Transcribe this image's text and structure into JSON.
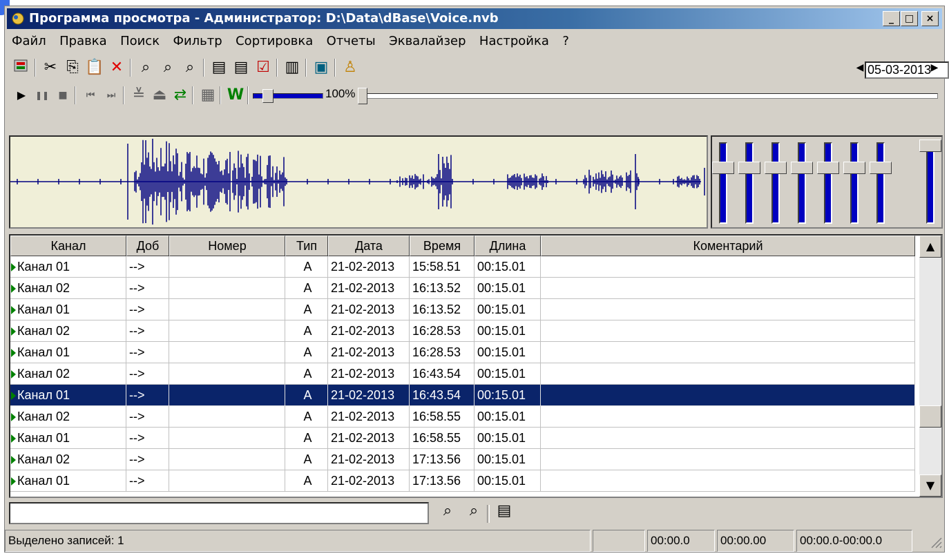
{
  "window": {
    "title": "Программа просмотра - Администратор: D:\\Data\\dBase\\Voice.nvb",
    "min": "_",
    "max": "□",
    "close": "×"
  },
  "menu": [
    {
      "label": "Файл"
    },
    {
      "label": "Правка"
    },
    {
      "label": "Поиск"
    },
    {
      "label": "Фильтр"
    },
    {
      "label": "Сортировка"
    },
    {
      "label": "Отчеты"
    },
    {
      "label": "Эквалайзер"
    },
    {
      "label": "Настройка"
    },
    {
      "label": "?"
    }
  ],
  "toolbar": {
    "date": "05-03-2013",
    "prev_date": "◀",
    "next_date": "▶"
  },
  "player": {
    "volume_label": "100%"
  },
  "table": {
    "headers": [
      "Канал",
      "Доб",
      "Номер",
      "Тип",
      "Дата",
      "Время",
      "Длина",
      "Коментарий"
    ],
    "rows": [
      {
        "channel": "Канал 01",
        "dob": "-->",
        "number": "",
        "type": "A",
        "date": "21-02-2013",
        "time": "15:58.51",
        "length": "00:15.01",
        "comment": ""
      },
      {
        "channel": "Канал 02",
        "dob": "-->",
        "number": "",
        "type": "A",
        "date": "21-02-2013",
        "time": "16:13.52",
        "length": "00:15.01",
        "comment": ""
      },
      {
        "channel": "Канал 01",
        "dob": "-->",
        "number": "",
        "type": "A",
        "date": "21-02-2013",
        "time": "16:13.52",
        "length": "00:15.01",
        "comment": ""
      },
      {
        "channel": "Канал 02",
        "dob": "-->",
        "number": "",
        "type": "A",
        "date": "21-02-2013",
        "time": "16:28.53",
        "length": "00:15.01",
        "comment": ""
      },
      {
        "channel": "Канал 01",
        "dob": "-->",
        "number": "",
        "type": "A",
        "date": "21-02-2013",
        "time": "16:28.53",
        "length": "00:15.01",
        "comment": ""
      },
      {
        "channel": "Канал 02",
        "dob": "-->",
        "number": "",
        "type": "A",
        "date": "21-02-2013",
        "time": "16:43.54",
        "length": "00:15.01",
        "comment": ""
      },
      {
        "channel": "Канал 01",
        "dob": "-->",
        "number": "",
        "type": "A",
        "date": "21-02-2013",
        "time": "16:43.54",
        "length": "00:15.01",
        "comment": "",
        "selected": true
      },
      {
        "channel": "Канал 02",
        "dob": "-->",
        "number": "",
        "type": "A",
        "date": "21-02-2013",
        "time": "16:58.55",
        "length": "00:15.01",
        "comment": ""
      },
      {
        "channel": "Канал 01",
        "dob": "-->",
        "number": "",
        "type": "A",
        "date": "21-02-2013",
        "time": "16:58.55",
        "length": "00:15.01",
        "comment": ""
      },
      {
        "channel": "Канал 02",
        "dob": "-->",
        "number": "",
        "type": "A",
        "date": "21-02-2013",
        "time": "17:13.56",
        "length": "00:15.01",
        "comment": ""
      },
      {
        "channel": "Канал 01",
        "dob": "-->",
        "number": "",
        "type": "A",
        "date": "21-02-2013",
        "time": "17:13.56",
        "length": "00:15.01",
        "comment": ""
      }
    ]
  },
  "search": {
    "value": ""
  },
  "statusbar": {
    "selected": "Выделено записей: 1",
    "empty": "",
    "pos1": "00:00.0",
    "pos2": "00:00.00",
    "range": "00:00.0-00:00.0"
  },
  "colors": {
    "selection": "#0a246a",
    "waveform": "#000080",
    "wave_bg": "#f0efd8",
    "eq": "#0000c0"
  }
}
